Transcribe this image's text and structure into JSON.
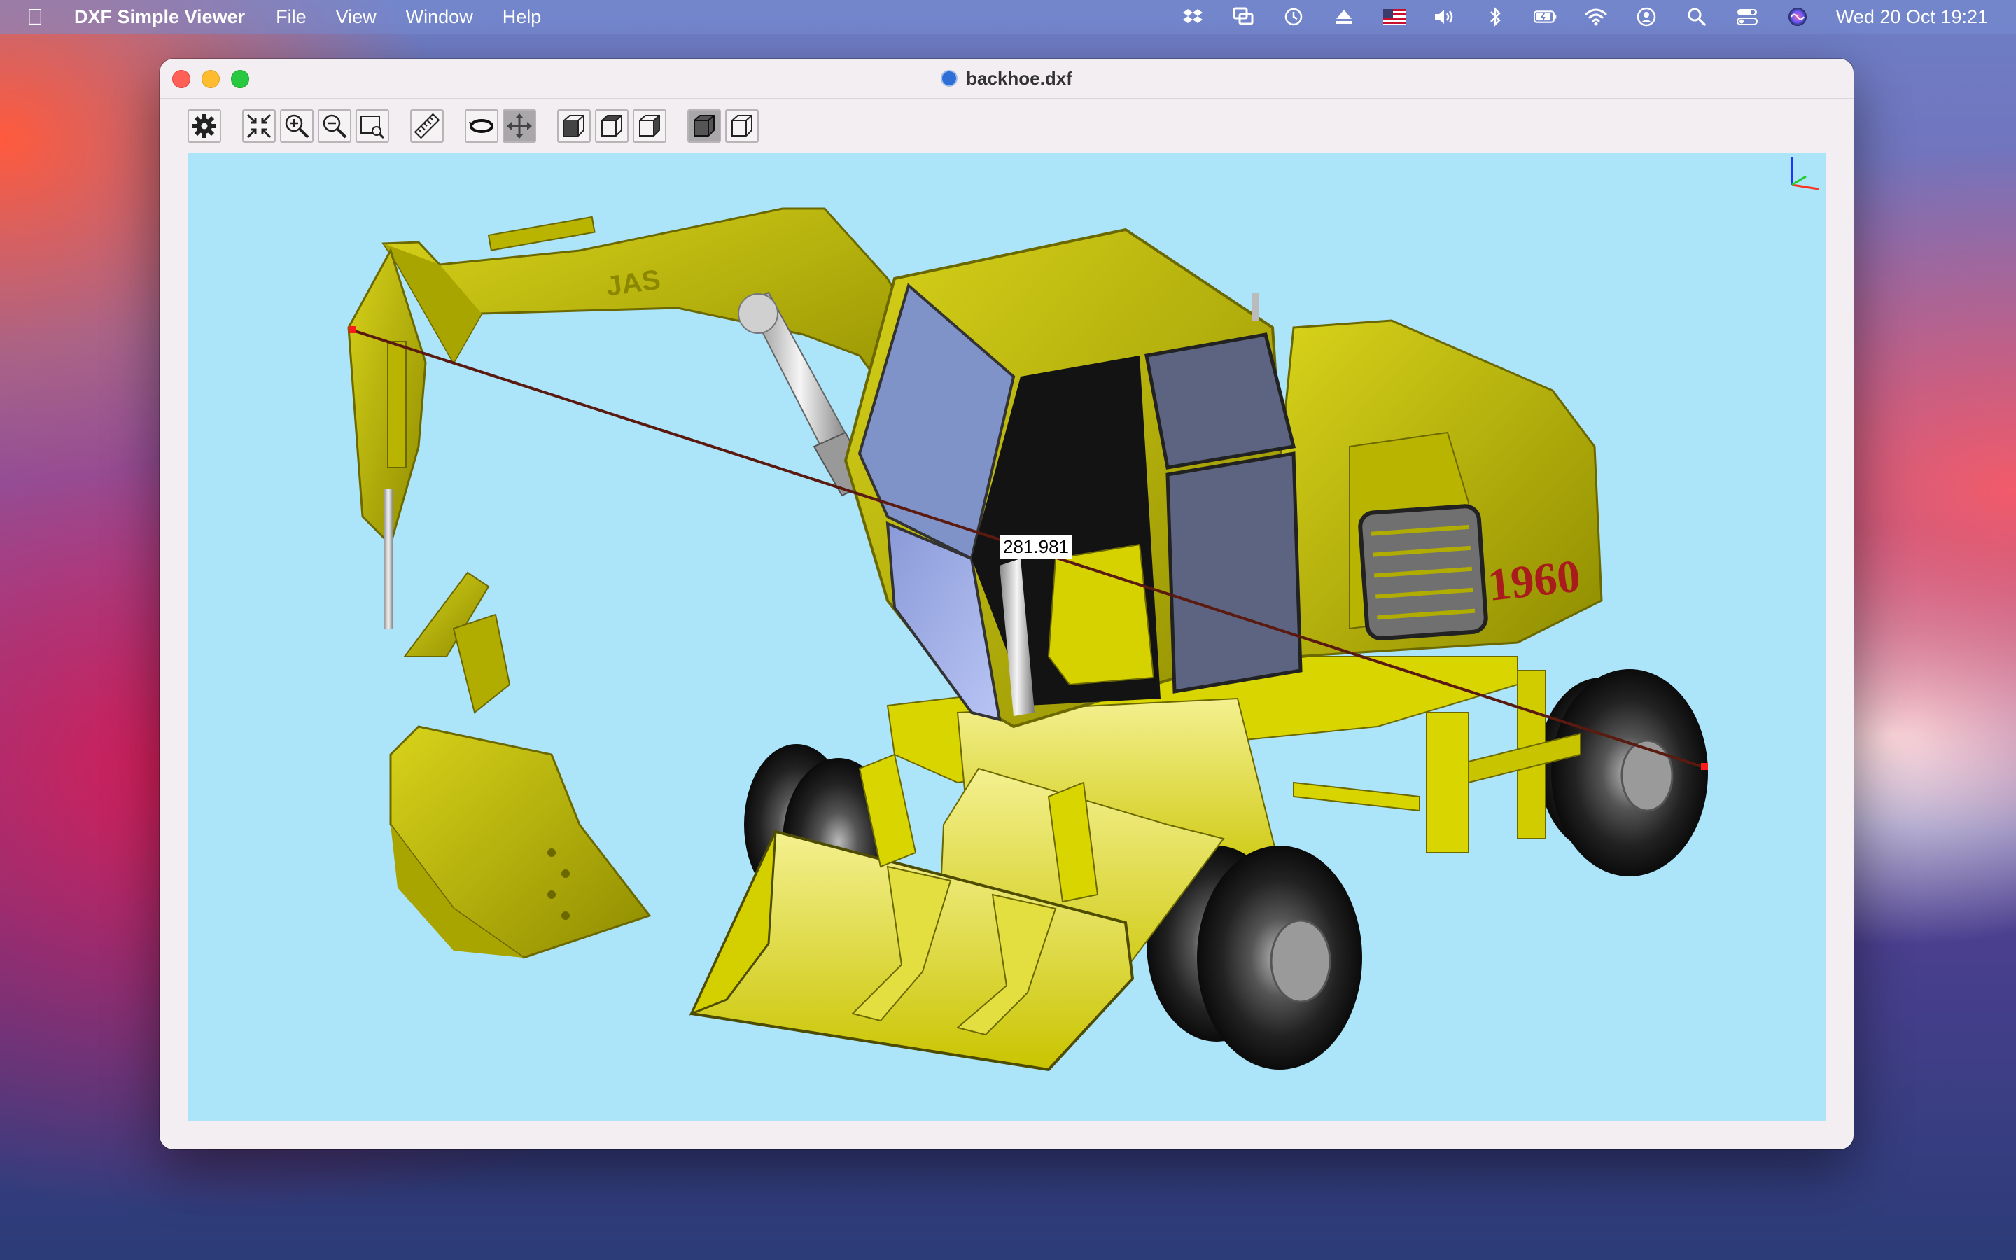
{
  "menubar": {
    "app_name": "DXF Simple Viewer",
    "menus": [
      "File",
      "View",
      "Window",
      "Help"
    ],
    "status_icons": [
      "dropbox-icon",
      "screen-mirror-icon",
      "time-machine-icon",
      "eject-icon",
      "us-flag-icon",
      "volume-icon",
      "bluetooth-icon",
      "battery-icon",
      "wifi-icon",
      "user-icon",
      "spotlight-icon",
      "control-center-icon",
      "siri-icon"
    ],
    "clock": "Wed 20 Oct  19:21"
  },
  "window": {
    "title": "backhoe.dxf"
  },
  "toolbar": {
    "tools": [
      "settings-icon",
      "fit-all-icon",
      "zoom-in-icon",
      "zoom-out-icon",
      "zoom-window-icon",
      "measure-ruler-icon",
      "rotate-icon",
      "pan-icon",
      "view-front-icon",
      "view-top-icon",
      "view-side-icon",
      "shaded-mode-icon",
      "wireframe-mode-icon"
    ],
    "active_tools": [
      "pan-icon",
      "shaded-mode-icon"
    ]
  },
  "viewport": {
    "background_color": "#ace4fa",
    "model_color": "#c8c400",
    "measure_line_color": "#5a1a10",
    "measurement": "281.981",
    "model_decal_text": "1960",
    "model_logo_text": "JAS"
  }
}
